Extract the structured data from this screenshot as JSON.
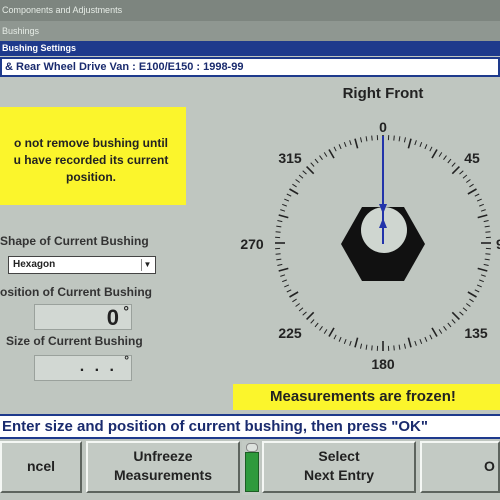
{
  "window": {
    "menu_path": "Components and Adjustments",
    "menu_sub": "Bushings",
    "title": "Bushing Settings",
    "vehicle": "& Rear Wheel Drive Van : E100/E150 : 1998-99"
  },
  "note": {
    "line1": "o not remove bushing until",
    "line2": "u have recorded its current",
    "line3": "position."
  },
  "form": {
    "shape_label": "Shape of Current Bushing",
    "shape_value": "Hexagon",
    "position_label": "osition of Current Bushing",
    "position_value": "0",
    "position_unit": "°",
    "size_label": "Size of Current Bushing",
    "size_value": ". . .",
    "size_unit": "°"
  },
  "dial": {
    "title": "Right Front",
    "labels": {
      "top": "0",
      "tr": "45",
      "right": "9",
      "br": "135",
      "bottom": "180",
      "bl": "225",
      "left": "270",
      "tl": "315"
    },
    "reading": 0,
    "colors": {
      "pointer": "#2233aa",
      "bushing": "#111111"
    }
  },
  "status": {
    "frozen": "Measurements are frozen!"
  },
  "instruction": "Enter size and position of current bushing, then press \"OK\"",
  "buttons": {
    "cancel": "ncel",
    "unfreeze_line1": "Unfreeze",
    "unfreeze_line2": "Measurements",
    "select_line1": "Select",
    "select_line2": "Next Entry",
    "ok": "O"
  },
  "colors": {
    "accent": "#1e3a8c",
    "highlight": "#fbf52c",
    "indicator": "#2e9a3c"
  }
}
